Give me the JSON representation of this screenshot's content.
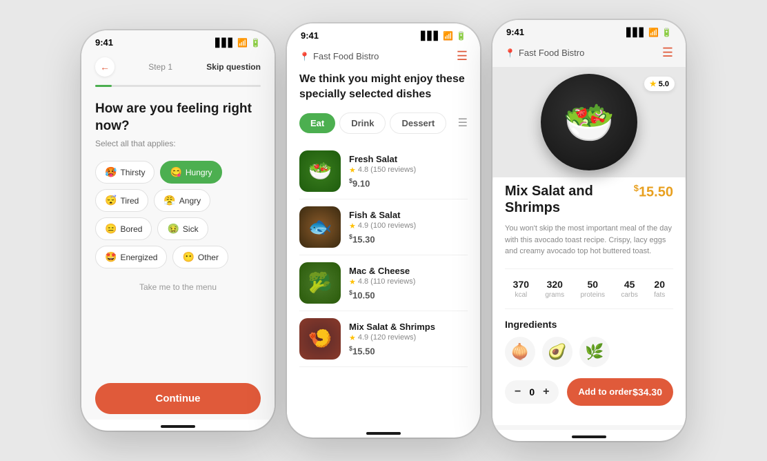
{
  "phone1": {
    "status_time": "9:41",
    "step_label": "Step 1",
    "skip_label": "Skip question",
    "question": "How are you feeling right now?",
    "sub_label": "Select all that applies:",
    "moods": [
      {
        "label": "Thirsty",
        "emoji": "🥵",
        "active": false
      },
      {
        "label": "Hungry",
        "emoji": "😋",
        "active": true
      },
      {
        "label": "Tired",
        "emoji": "😴",
        "active": false
      },
      {
        "label": "Angry",
        "emoji": "😤",
        "active": false
      },
      {
        "label": "Bored",
        "emoji": "😑",
        "active": false
      },
      {
        "label": "Sick",
        "emoji": "🤢",
        "active": false
      },
      {
        "label": "Energized",
        "emoji": "🤩",
        "active": false
      },
      {
        "label": "Other",
        "emoji": "😶",
        "active": false
      }
    ],
    "take_me_link": "Take me to the menu",
    "continue_btn": "Continue"
  },
  "phone2": {
    "status_time": "9:41",
    "restaurant_name": "Fast Food Bistro",
    "menu_icon": "☰",
    "recommend_text": "We think you might enjoy these specially selected dishes",
    "tabs": [
      {
        "label": "Eat",
        "active": true
      },
      {
        "label": "Drink",
        "active": false
      },
      {
        "label": "Dessert",
        "active": false
      }
    ],
    "foods": [
      {
        "name": "Fresh Salat",
        "rating": "4.8",
        "reviews": "150 reviews",
        "price": "9.10",
        "emoji": "🥗"
      },
      {
        "name": "Fish & Salat",
        "rating": "4.9",
        "reviews": "100 reviews",
        "price": "15.30",
        "emoji": "🐟"
      },
      {
        "name": "Mac & Cheese",
        "rating": "4.8",
        "reviews": "110 reviews",
        "price": "10.50",
        "emoji": "🥦"
      },
      {
        "name": "Mix Salat & Shrimps",
        "rating": "4.9",
        "reviews": "120 reviews",
        "price": "15.50",
        "emoji": "🍤"
      }
    ]
  },
  "phone3": {
    "status_time": "9:41",
    "restaurant_name": "Fast Food Bistro",
    "menu_icon": "☰",
    "rating": "5.0",
    "dish_name": "Mix Salat and Shrimps",
    "dish_price": "15.50",
    "dish_desc": "You won't skip the most important meal of the day with this avocado toast recipe. Crispy, lacy eggs and creamy avocado top hot buttered toast.",
    "nutrition": [
      {
        "value": "370",
        "label": "kcal"
      },
      {
        "value": "320",
        "label": "grams"
      },
      {
        "value": "50",
        "label": "proteins"
      },
      {
        "value": "45",
        "label": "carbs"
      },
      {
        "value": "20",
        "label": "fats"
      }
    ],
    "ingredients_title": "Ingredients",
    "ingredients": [
      "🧅",
      "🥑",
      "🌿"
    ],
    "qty": "0",
    "add_btn_label": "Add to order",
    "add_btn_price": "$34.30"
  }
}
